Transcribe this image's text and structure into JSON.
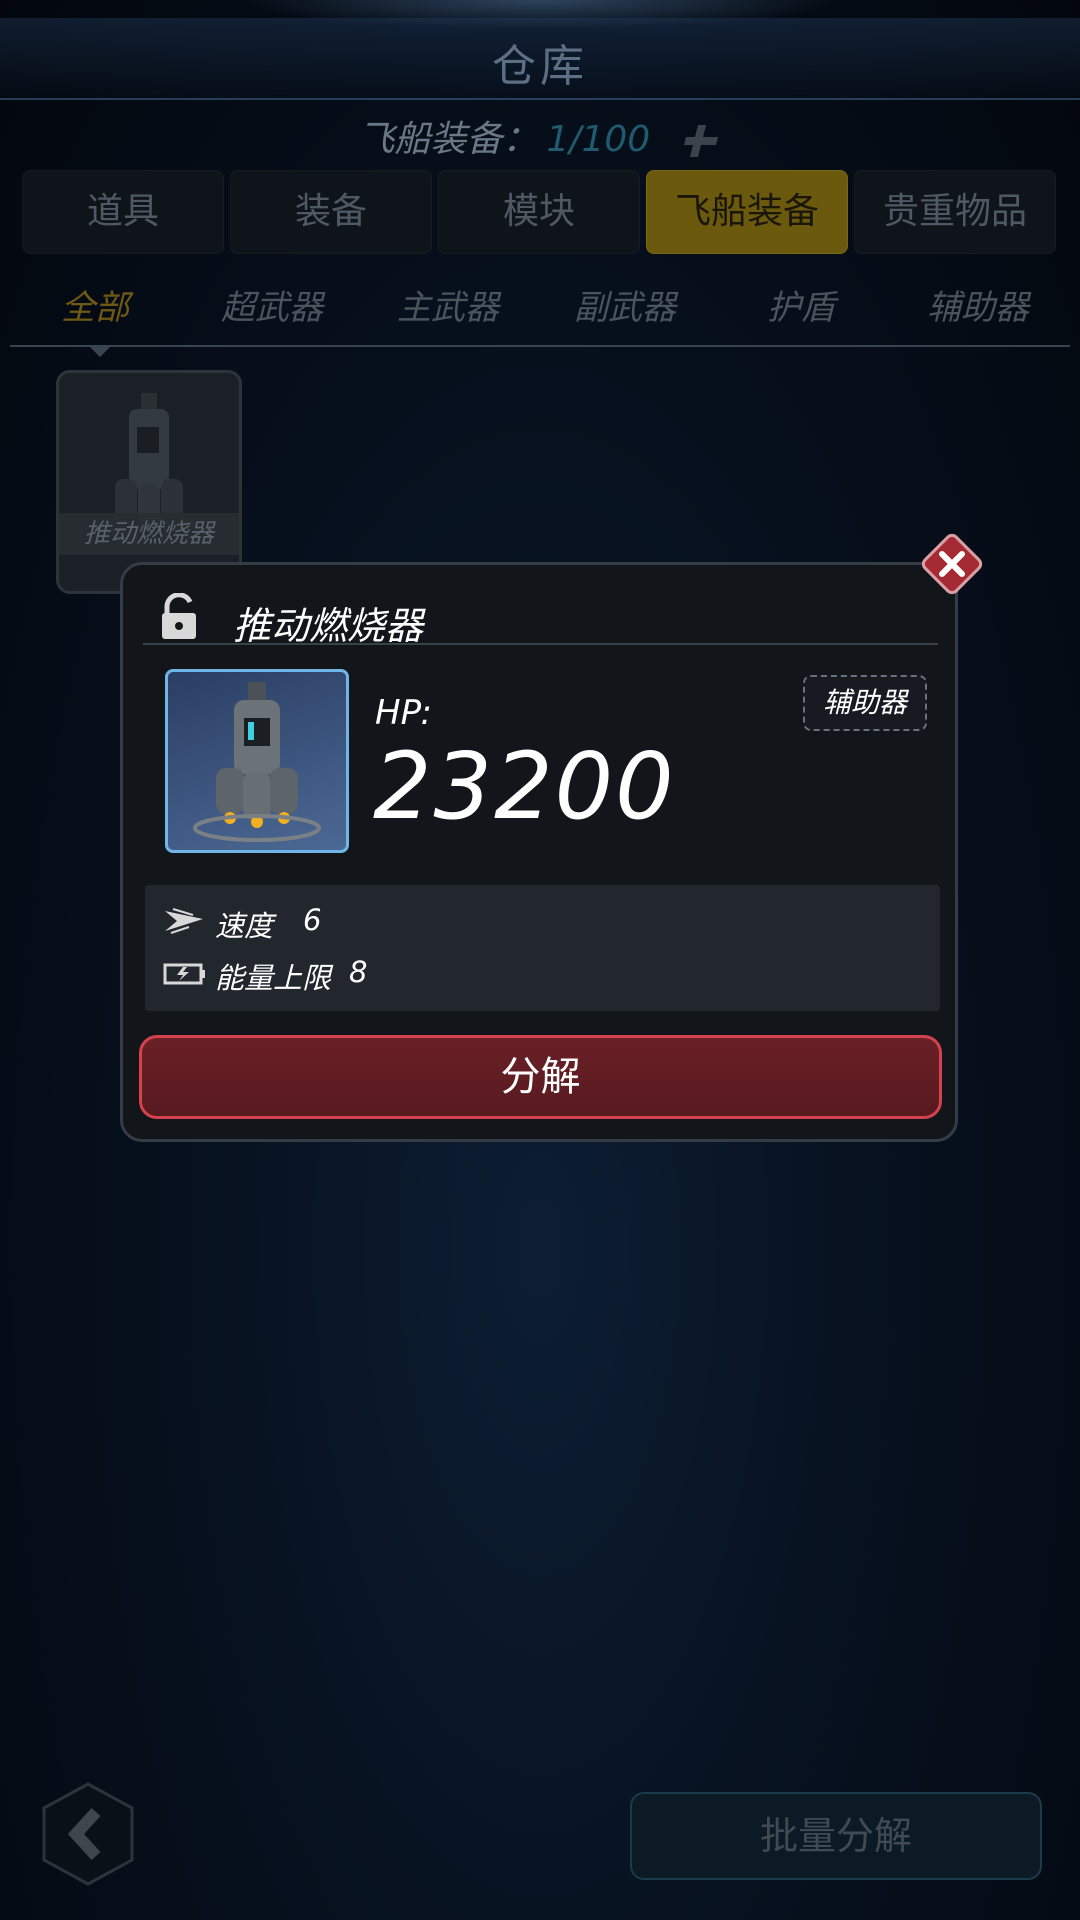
{
  "header": {
    "title": "仓库",
    "capacity_label": "飞船装备：",
    "capacity_value": "1/100",
    "add_icon": "plus-icon"
  },
  "main_tabs": [
    {
      "label": "道具",
      "active": false
    },
    {
      "label": "装备",
      "active": false
    },
    {
      "label": "模块",
      "active": false
    },
    {
      "label": "飞船装备",
      "active": true
    },
    {
      "label": "贵重物品",
      "active": false
    }
  ],
  "sub_tabs": [
    {
      "label": "全部",
      "active": true
    },
    {
      "label": "超武器",
      "active": false
    },
    {
      "label": "主武器",
      "active": false
    },
    {
      "label": "副武器",
      "active": false
    },
    {
      "label": "护盾",
      "active": false
    },
    {
      "label": "辅助器",
      "active": false
    }
  ],
  "inventory": [
    {
      "name": "推动燃烧器",
      "icon": "thruster-icon"
    }
  ],
  "popup": {
    "title": "推动燃烧器",
    "lock_icon": "unlock-icon",
    "hp_label": "HP:",
    "hp_value": "23200",
    "type_badge": "辅助器",
    "stats": [
      {
        "icon": "speed-icon",
        "name": "速度",
        "value": "6"
      },
      {
        "icon": "battery-icon",
        "name": "能量上限",
        "value": "8"
      }
    ],
    "action_label": "分解",
    "close_icon": "close-icon"
  },
  "footer": {
    "back_icon": "chevron-left-icon",
    "batch_label": "批量分解"
  },
  "colors": {
    "active_tab": "#6b5a0e",
    "decompose_border": "#d5424f",
    "art_border": "#6fb5e8"
  }
}
